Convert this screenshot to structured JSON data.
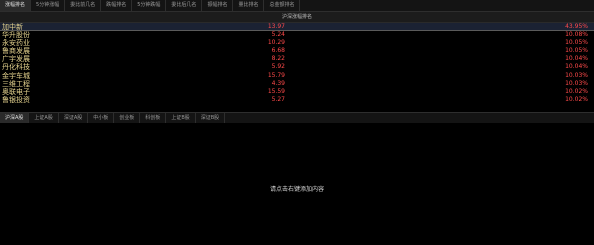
{
  "top_tabs": [
    {
      "label": "涨幅排名",
      "active": true
    },
    {
      "label": "5分钟涨幅",
      "active": false
    },
    {
      "label": "委比前几名",
      "active": false
    },
    {
      "label": "跌幅排名",
      "active": false
    },
    {
      "label": "5分钟跌幅",
      "active": false
    },
    {
      "label": "委比后几名",
      "active": false
    },
    {
      "label": "振幅排名",
      "active": false
    },
    {
      "label": "量比排名",
      "active": false
    },
    {
      "label": "总金额排名",
      "active": false
    }
  ],
  "panel_title": "沪深涨幅排名",
  "rows": [
    {
      "name": "加中新",
      "price": "13.97",
      "pct": "43.95%",
      "selected": true
    },
    {
      "name": "华升股份",
      "price": "5.24",
      "pct": "10.08%",
      "selected": false
    },
    {
      "name": "永安药业",
      "price": "10.29",
      "pct": "10.05%",
      "selected": false
    },
    {
      "name": "鲁商发展",
      "price": "6.68",
      "pct": "10.05%",
      "selected": false
    },
    {
      "name": "广宇发展",
      "price": "8.22",
      "pct": "10.04%",
      "selected": false
    },
    {
      "name": "丹化科技",
      "price": "5.92",
      "pct": "10.04%",
      "selected": false
    },
    {
      "name": "金宇车城",
      "price": "15.79",
      "pct": "10.03%",
      "selected": false
    },
    {
      "name": "三维工程",
      "price": "4.39",
      "pct": "10.03%",
      "selected": false
    },
    {
      "name": "奥联电子",
      "price": "15.59",
      "pct": "10.02%",
      "selected": false
    },
    {
      "name": "鲁银投资",
      "price": "5.27",
      "pct": "10.02%",
      "selected": false
    }
  ],
  "bottom_tabs": [
    {
      "label": "沪深A股",
      "active": true
    },
    {
      "label": "上证A股",
      "active": false
    },
    {
      "label": "深证A股",
      "active": false
    },
    {
      "label": "中小板",
      "active": false
    },
    {
      "label": "创业板",
      "active": false
    },
    {
      "label": "科创板",
      "active": false
    },
    {
      "label": "上证B股",
      "active": false
    },
    {
      "label": "深证B股",
      "active": false
    }
  ],
  "empty_message": "请点击右键添加内容"
}
